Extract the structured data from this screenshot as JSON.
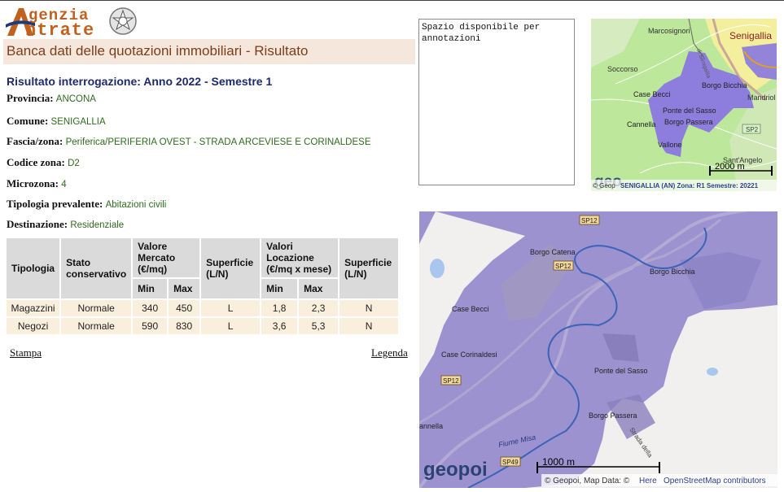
{
  "header": {
    "logo_line1": "genzia",
    "logo_line2": "ntrate",
    "logo_initials": "A",
    "title": "Banca dati delle quotazioni immobiliari - Risultato"
  },
  "result_title": "Risultato interrogazione: Anno 2022 - Semestre 1",
  "fields": {
    "provincia": {
      "label": "Provincia:",
      "value": "ANCONA"
    },
    "comune": {
      "label": "Comune:",
      "value": "SENIGALLIA"
    },
    "fascia": {
      "label": "Fascia/zona:",
      "value": "Periferica/PERIFERIA OVEST - STRADA ARCEVIESE E CORINALDESE"
    },
    "codice": {
      "label": "Codice zona:",
      "value": "D2"
    },
    "microzona": {
      "label": "Microzona:",
      "value": "4"
    },
    "tipologia": {
      "label": "Tipologia prevalente:",
      "value": "Abitazioni civili"
    },
    "destinazione": {
      "label": "Destinazione:",
      "value": "Residenziale"
    }
  },
  "table": {
    "headers": {
      "tipologia": "Tipologia",
      "stato": "Stato conservativo",
      "valore": "Valore Mercato (€/mq)",
      "superficie": "Superficie (L/N)",
      "locazione": "Valori Locazione (€/mq x mese)",
      "superficie2": "Superficie (L/N)",
      "min": "Min",
      "max": "Max"
    },
    "rows": [
      {
        "tipologia": "Magazzini",
        "stato": "Normale",
        "vmin": "340",
        "vmax": "450",
        "sup": "L",
        "lmin": "1,8",
        "lmax": "2,3",
        "sup2": "N"
      },
      {
        "tipologia": "Negozi",
        "stato": "Normale",
        "vmin": "590",
        "vmax": "830",
        "sup": "L",
        "lmin": "3,6",
        "lmax": "5,3",
        "sup2": "N"
      }
    ]
  },
  "links": {
    "stampa": "Stampa",
    "legenda": "Legenda"
  },
  "notes": {
    "value": "Spazio disponibile per\nannotazioni"
  },
  "map_small": {
    "labels": [
      "Marcosignori",
      "Soccorso",
      "Senigallia",
      "Borgo Bicchia",
      "Case Becci",
      "Ponte del Sasso",
      "Borgo Passera",
      "Cannella",
      "Vallone",
      "Mandriol",
      "Sant'Angelo",
      "SP2"
    ],
    "scale": "2000 m",
    "caption": "SENIGALLIA (AN) Zona: R1 Semestre: 20221",
    "copyright": "© Geop",
    "street_label": "di Senigallia",
    "watermark": "geo",
    "colors": {
      "zone": "#8a78e0",
      "land": "#bde79a",
      "urban": "#f3ef9c"
    }
  },
  "map_large": {
    "labels": [
      "Borgo Catena",
      "Borgo Bicchia",
      "Case Becci",
      "Case Corinaldesi",
      "Ponte del Sasso",
      "Borgo Passera",
      "annella",
      "Fiume Misa",
      "Strada della"
    ],
    "road_badges": [
      "SP12",
      "SP12",
      "SP12",
      "SP49"
    ],
    "scale": "1000 m",
    "copyright_prefix": "© Geopoi, Map Data: ©",
    "copyright_here": "Here",
    "copyright_osm": "OpenStreetMap contributors",
    "watermark": "geopoi",
    "colors": {
      "zone": "#9b92cf",
      "river": "#3d63b8"
    }
  }
}
